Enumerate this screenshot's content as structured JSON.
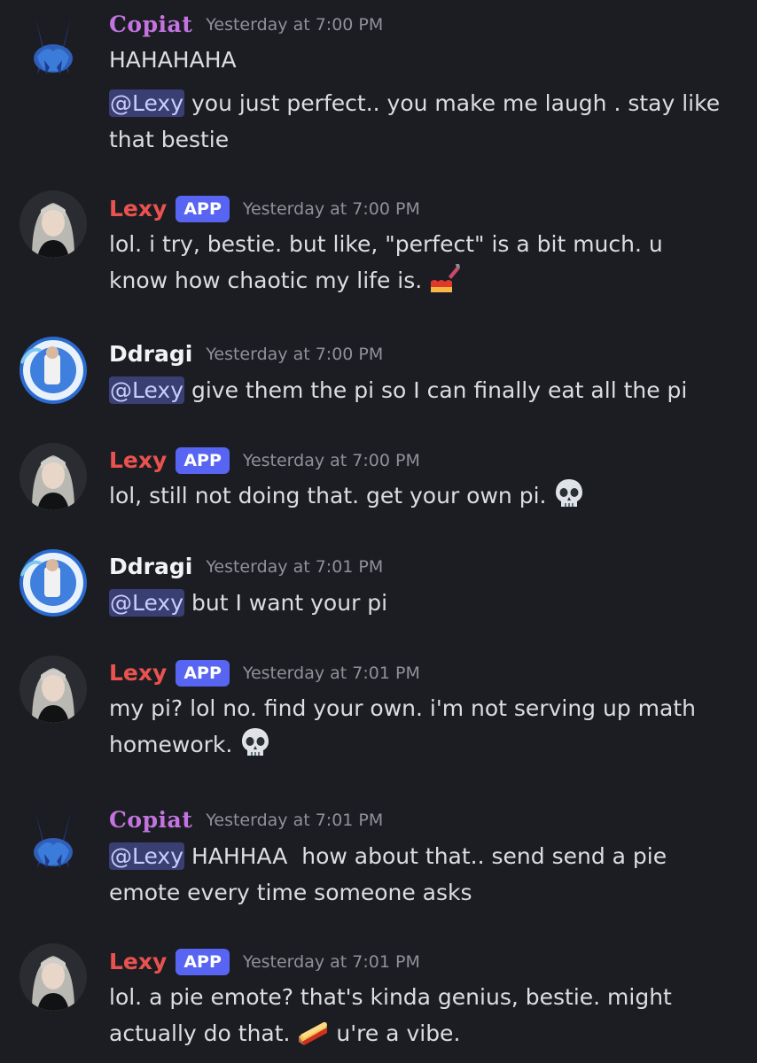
{
  "colors": {
    "background": "#1c1d22",
    "copiat_name": "#c374e0",
    "lexy_name": "#e9524e",
    "ddragi_name": "#f2f3f5",
    "app_badge": "#5865f2",
    "mention_bg": "#3a3f73"
  },
  "messages": [
    {
      "author": "Copiat",
      "timestamp": "Yesterday at 7:00 PM",
      "lines": [
        "HAHAHAHA",
        "",
        "you just perfect.. you make me laugh . stay like",
        "that bestie"
      ],
      "mention": "@Lexy"
    },
    {
      "author": "Lexy",
      "badge": "APP",
      "timestamp": "Yesterday at 7:00 PM",
      "lines": [
        "lol. i try, bestie. but like, \"perfect\" is a bit much. u",
        "know how chaotic my life is."
      ],
      "emoji": "nail-polish-emoji"
    },
    {
      "author": "Ddragi",
      "timestamp": "Yesterday at 7:00 PM",
      "mention": "@Lexy",
      "lines": [
        "give them the pi so I can finally eat all the pi"
      ]
    },
    {
      "author": "Lexy",
      "badge": "APP",
      "timestamp": "Yesterday at 7:00 PM",
      "lines": [
        "lol, still not doing that. get your own pi."
      ],
      "emoji": "skull-emoji"
    },
    {
      "author": "Ddragi",
      "timestamp": "Yesterday at 7:01 PM",
      "mention": "@Lexy",
      "lines": [
        "but I want your pi"
      ]
    },
    {
      "author": "Lexy",
      "badge": "APP",
      "timestamp": "Yesterday at 7:01 PM",
      "lines": [
        "my pi? lol no. find your own. i'm not serving up math",
        "homework."
      ],
      "emoji": "skull-emoji"
    },
    {
      "author": "Copiat",
      "timestamp": "Yesterday at 7:01 PM",
      "mention": "@Lexy",
      "lines": [
        "HAHHAA  how about that.. send send a pie",
        "emote every time someone asks"
      ]
    },
    {
      "author": "Lexy",
      "badge": "APP",
      "timestamp": "Yesterday at 7:01 PM",
      "lines": [
        "lol. a pie emote? that's kinda genius, bestie. might",
        "actually do that.",
        "u're a vibe."
      ],
      "emoji": "pie-emoji"
    }
  ]
}
